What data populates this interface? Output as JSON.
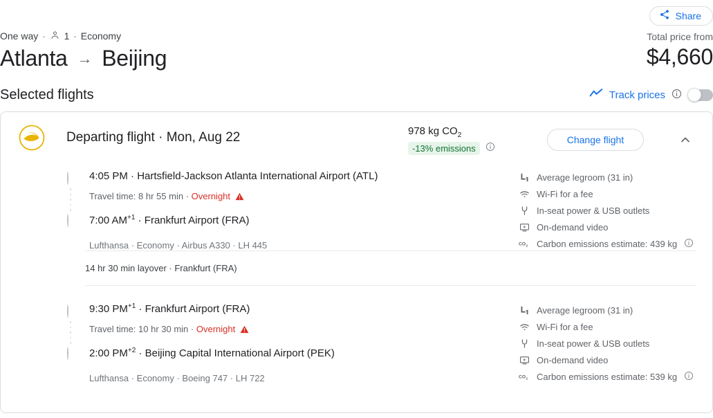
{
  "header": {
    "share_label": "Share",
    "trip_type": "One way",
    "passengers": "1",
    "cabin": "Economy",
    "origin": "Atlanta",
    "destination": "Beijing",
    "arrow": "→",
    "dot_sep": "·",
    "price_label": "Total price from",
    "price_value": "$4,660"
  },
  "selected": {
    "title": "Selected flights",
    "track_label": "Track prices",
    "toggle_state": "off"
  },
  "card": {
    "airline": "Lufthansa",
    "title": "Departing flight",
    "date": "Mon, Aug 22",
    "co2_amount": "978 kg CO",
    "co2_sub": "2",
    "co2_badge": "-13% emissions",
    "change_flight_label": "Change flight",
    "legs": [
      {
        "depart_time": "4:05 PM",
        "depart_sup": "",
        "depart_airport": "Hartsfield-Jackson Atlanta International Airport (ATL)",
        "travel_time": "Travel time: 8 hr 55 min",
        "overnight": "Overnight",
        "arrive_time": "7:00 AM",
        "arrive_sup": "+1",
        "arrive_airport": "Frankfurt Airport (FRA)",
        "operator": "Lufthansa · Economy · Airbus A330 · LH 445",
        "amenities": [
          {
            "icon": "legroom-icon",
            "label": "Average legroom (31 in)",
            "info": false
          },
          {
            "icon": "wifi-icon",
            "label": "Wi-Fi for a fee",
            "info": false
          },
          {
            "icon": "power-outlet-icon",
            "label": "In-seat power & USB outlets",
            "info": false
          },
          {
            "icon": "video-icon",
            "label": "On-demand video",
            "info": false
          },
          {
            "icon": "co2-icon",
            "label": "Carbon emissions estimate: 439 kg",
            "info": true
          }
        ]
      },
      {
        "depart_time": "9:30 PM",
        "depart_sup": "+1",
        "depart_airport": "Frankfurt Airport (FRA)",
        "travel_time": "Travel time: 10 hr 30 min",
        "overnight": "Overnight",
        "arrive_time": "2:00 PM",
        "arrive_sup": "+2",
        "arrive_airport": "Beijing Capital International Airport (PEK)",
        "operator": "Lufthansa · Economy · Boeing 747 · LH 722",
        "amenities": [
          {
            "icon": "legroom-icon",
            "label": "Average legroom (31 in)",
            "info": false
          },
          {
            "icon": "wifi-icon",
            "label": "Wi-Fi for a fee",
            "info": false
          },
          {
            "icon": "power-outlet-icon",
            "label": "In-seat power & USB outlets",
            "info": false
          },
          {
            "icon": "video-icon",
            "label": "On-demand video",
            "info": false
          },
          {
            "icon": "co2-icon",
            "label": "Carbon emissions estimate: 539 kg",
            "info": true
          }
        ]
      }
    ],
    "layover": "14 hr 30 min layover · Frankfurt (FRA)"
  },
  "colors": {
    "link_blue": "#1a73e8",
    "warning_red": "#d93025",
    "eco_green_bg": "#e6f4ea",
    "eco_green_text": "#137333",
    "lufthansa_yellow": "#e9b301",
    "border_gray": "#dadce0"
  }
}
